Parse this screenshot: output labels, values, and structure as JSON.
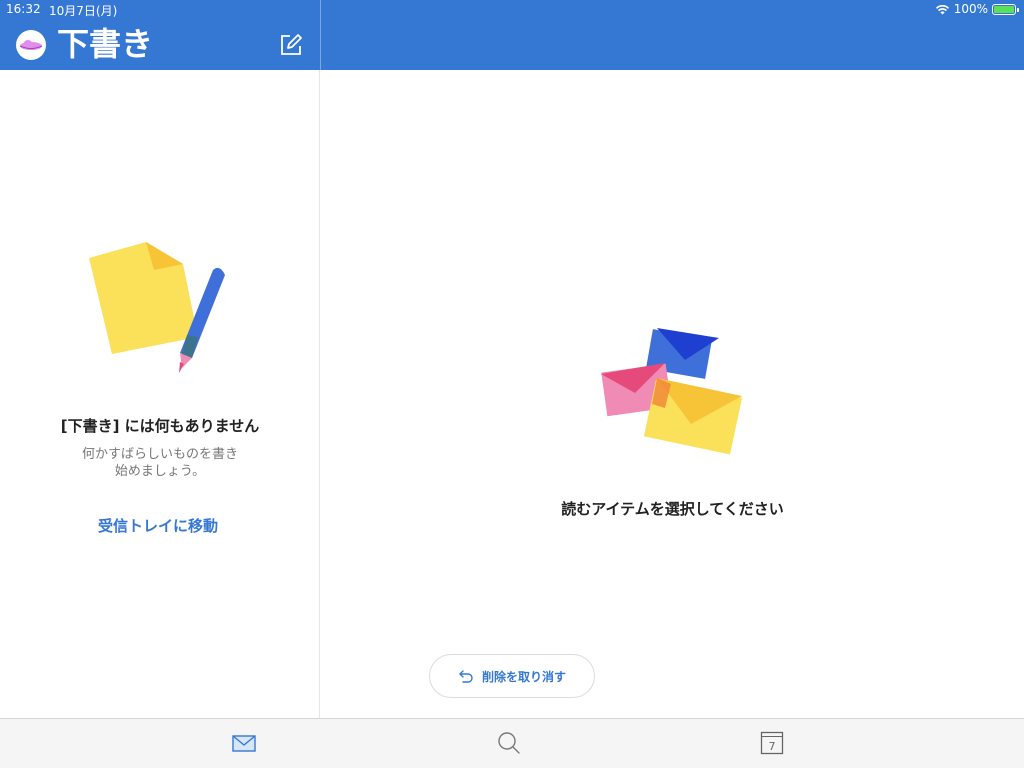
{
  "status_bar": {
    "time": "16:32",
    "date": "10月7日(月)",
    "battery_percent": "100%"
  },
  "header": {
    "title": "下書き",
    "compose_icon": "compose-icon",
    "avatar_icon": "avatar-icon"
  },
  "sidebar": {
    "empty_title": "[下書き] には何もありません",
    "empty_subtitle_line1": "何かすばらしいものを書き",
    "empty_subtitle_line2": "始めましょう。",
    "inbox_link": "受信トレイに移動",
    "illustration": "draft-pencil-illustration"
  },
  "reading_pane": {
    "select_message": "読むアイテムを選択してください",
    "illustration": "envelopes-illustration",
    "undo_label": "削除を取り消す"
  },
  "tabbar": {
    "tabs": [
      {
        "icon": "mail-icon",
        "active": true
      },
      {
        "icon": "search-icon",
        "active": false
      },
      {
        "icon": "calendar-icon",
        "day": "7",
        "active": false
      }
    ]
  },
  "colors": {
    "brand": "#3478d4",
    "yellow": "#fbe05a",
    "pink": "#ee5f8c",
    "blue_dark": "#1f3fd0"
  }
}
